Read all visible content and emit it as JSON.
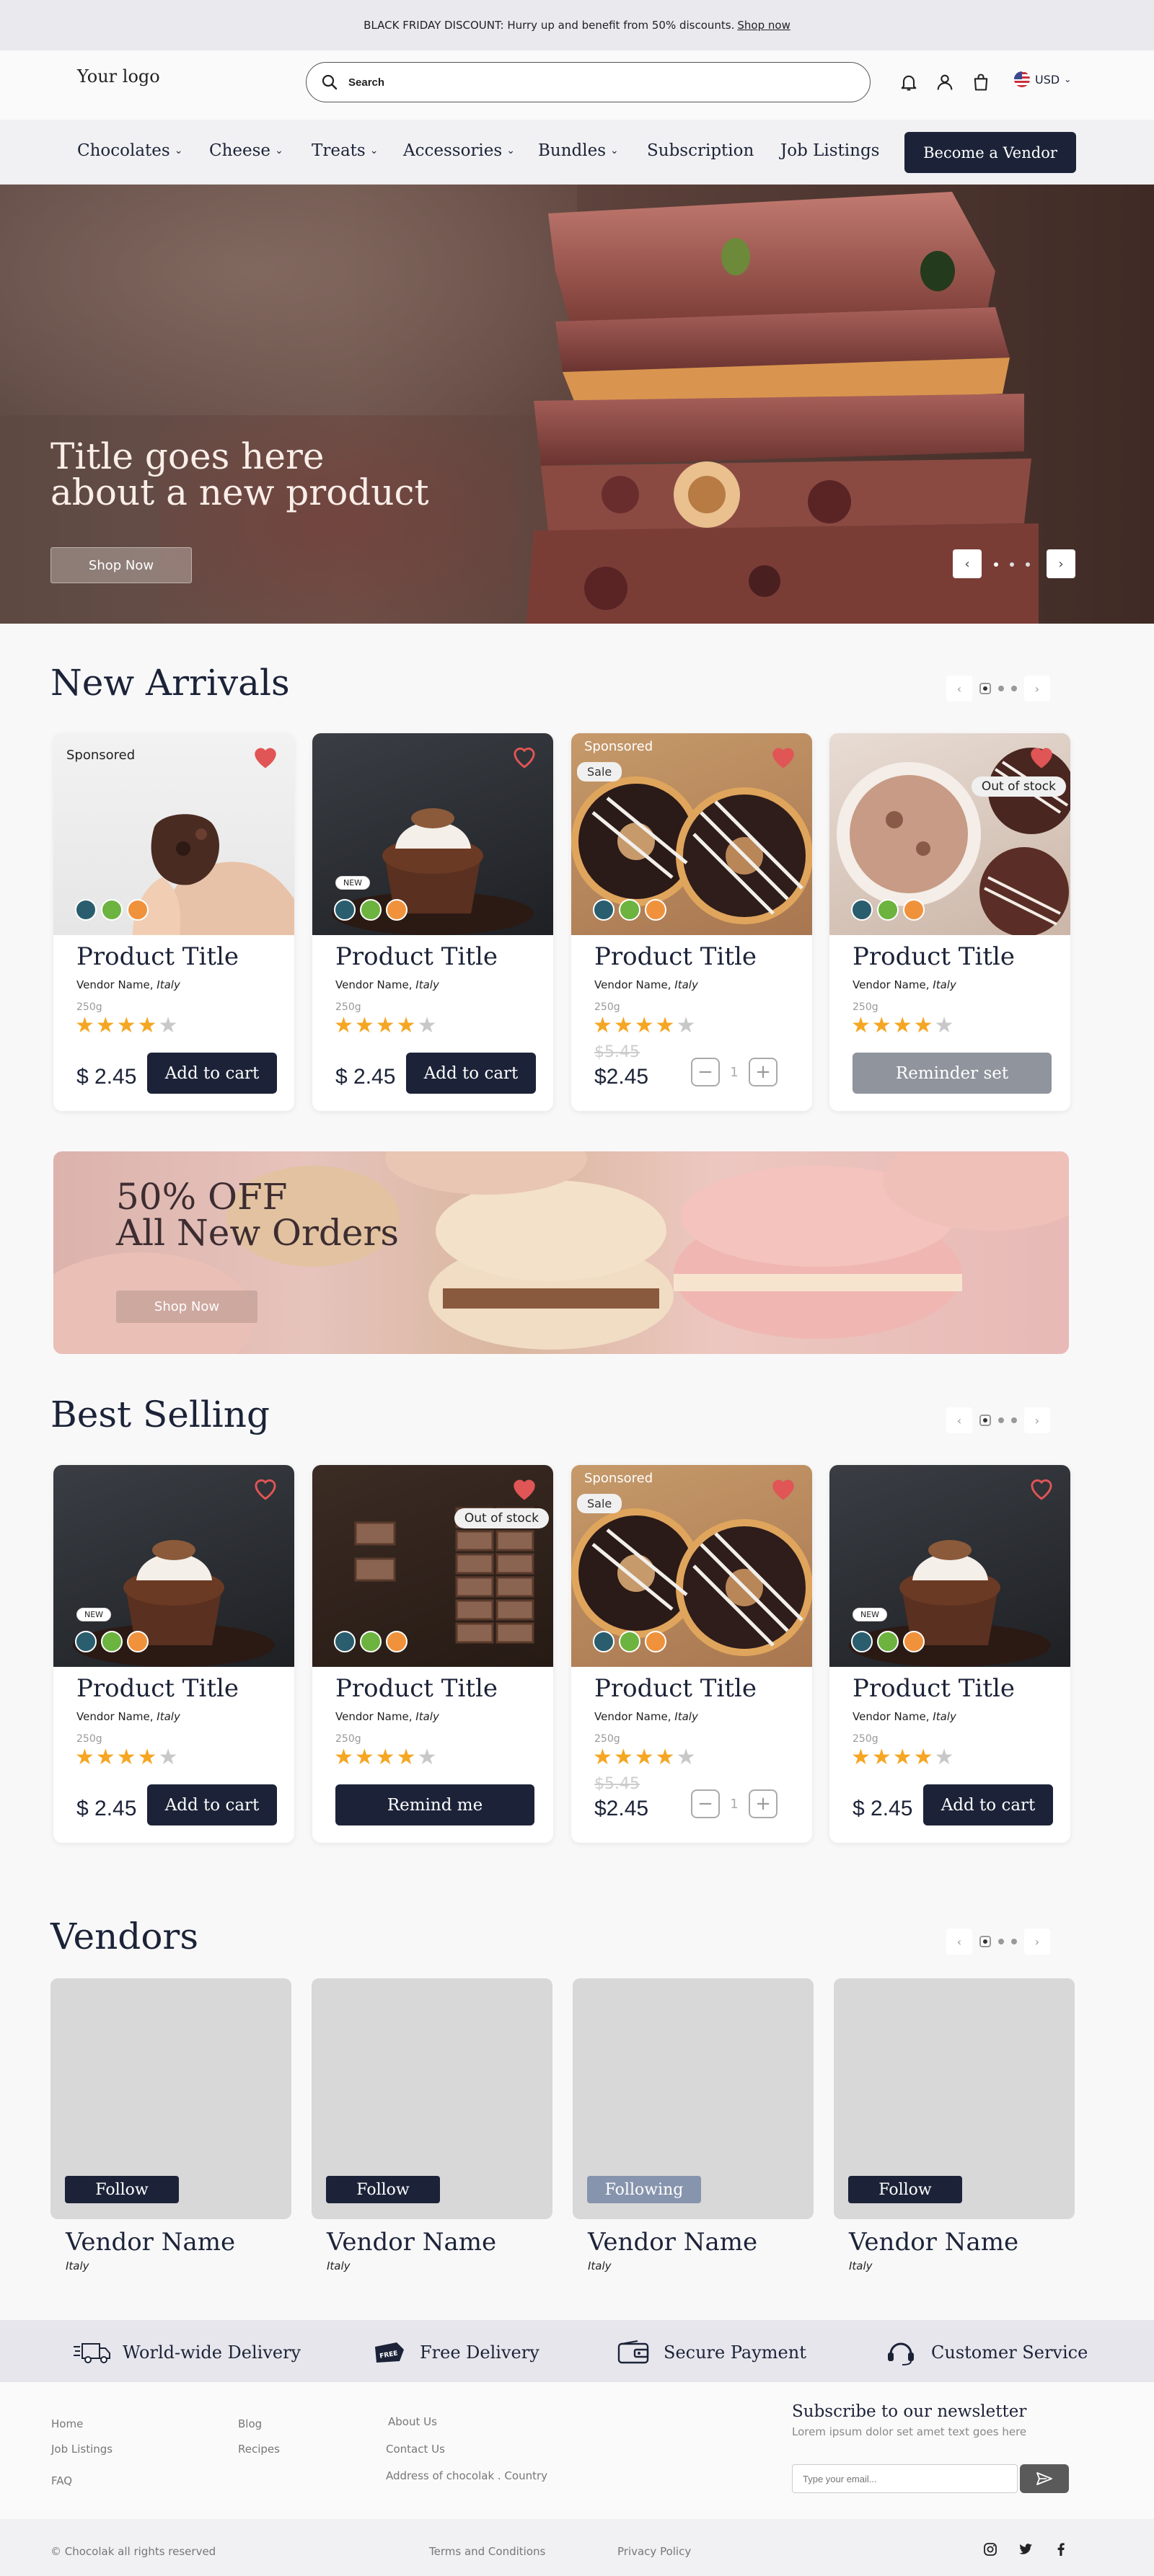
{
  "topbar": {
    "text": "BLACK FRIDAY DISCOUNT: Hurry up and benefit from 50% discounts.",
    "link": "Shop now"
  },
  "header": {
    "logo": "Your logo",
    "search_placeholder": "Search",
    "currency": "USD"
  },
  "nav": {
    "items": [
      {
        "label": "Chocolates",
        "chevron": true
      },
      {
        "label": "Cheese",
        "chevron": true
      },
      {
        "label": "Treats",
        "chevron": true
      },
      {
        "label": "Accessories",
        "chevron": true
      },
      {
        "label": "Bundles",
        "chevron": true
      },
      {
        "label": "Subscription",
        "chevron": false
      },
      {
        "label": "Job Listings",
        "chevron": false
      }
    ],
    "vendor_button": "Become a Vendor"
  },
  "hero": {
    "title_line1": "Title goes here",
    "title_line2": "about a new product",
    "button": "Shop Now"
  },
  "new_arrivals": {
    "title": "New Arrivals",
    "products": [
      {
        "badge": "Sponsored",
        "title": "Product Title",
        "vendor": "Vendor Name,",
        "country": "Italy",
        "weight": "250g",
        "rating": 4,
        "price": "$ 2.45",
        "action": "Add to cart"
      },
      {
        "badge": "NEW",
        "title": "Product Title",
        "vendor": "Vendor Name,",
        "country": "Italy",
        "weight": "250g",
        "rating": 4,
        "price": "$ 2.45",
        "action": "Add to cart"
      },
      {
        "badge": "Sponsored",
        "sale": "Sale",
        "title": "Product Title",
        "vendor": "Vendor Name,",
        "country": "Italy",
        "weight": "250g",
        "rating": 4,
        "old_price": "$5.45",
        "price": "$2.45",
        "qty": "1"
      },
      {
        "status": "Out of stock",
        "title": "Product Title",
        "vendor": "Vendor Name,",
        "country": "Italy",
        "weight": "250g",
        "rating": 4,
        "action": "Reminder set"
      }
    ]
  },
  "promo": {
    "line1": "50% OFF",
    "line2": "All New Orders",
    "button": "Shop Now"
  },
  "best_selling": {
    "title": "Best Selling",
    "products": [
      {
        "badge": "NEW",
        "title": "Product Title",
        "vendor": "Vendor Name,",
        "country": "Italy",
        "weight": "250g",
        "rating": 4,
        "price": "$ 2.45",
        "action": "Add to cart"
      },
      {
        "status": "Out of stock",
        "title": "Product Title",
        "vendor": "Vendor Name,",
        "country": "Italy",
        "weight": "250g",
        "rating": 4,
        "action": "Remind me"
      },
      {
        "badge": "Sponsored",
        "sale": "Sale",
        "title": "Product Title",
        "vendor": "Vendor Name,",
        "country": "Italy",
        "weight": "250g",
        "rating": 4,
        "old_price": "$5.45",
        "price": "$2.45",
        "qty": "1"
      },
      {
        "badge": "NEW",
        "title": "Product Title",
        "vendor": "Vendor Name,",
        "country": "Italy",
        "weight": "250g",
        "rating": 4,
        "price": "$ 2.45",
        "action": "Add to cart"
      }
    ]
  },
  "vendors": {
    "title": "Vendors",
    "items": [
      {
        "button": "Follow",
        "name": "Vendor Name",
        "country": "Italy"
      },
      {
        "button": "Follow",
        "name": "Vendor Name",
        "country": "Italy"
      },
      {
        "button": "Following",
        "name": "Vendor Name",
        "country": "Italy"
      },
      {
        "button": "Follow",
        "name": "Vendor Name",
        "country": "Italy"
      }
    ]
  },
  "features": [
    {
      "icon": "truck-icon",
      "label": "World-wide Delivery"
    },
    {
      "icon": "free-tag-icon",
      "label": "Free Delivery"
    },
    {
      "icon": "wallet-icon",
      "label": "Secure Payment"
    },
    {
      "icon": "headset-icon",
      "label": "Customer Service"
    }
  ],
  "footer": {
    "col1": [
      "Home",
      "Job Listings",
      "FAQ"
    ],
    "col2": [
      "Blog",
      "Recipes"
    ],
    "col3": [
      "About Us",
      "Contact Us",
      "Address of chocolak . Country"
    ],
    "newsletter_title": "Subscribe to our newsletter",
    "newsletter_sub": "Lorem ipsum dolor set amet text goes here",
    "email_placeholder": "Type your email..."
  },
  "bottom": {
    "copyright": "© Chocolak all rights reserved",
    "terms": "Terms and Conditions",
    "privacy": "Privacy Policy"
  },
  "colors": {
    "primary": "#1c2338",
    "star": "#f5a623",
    "heart": "#e05555"
  }
}
